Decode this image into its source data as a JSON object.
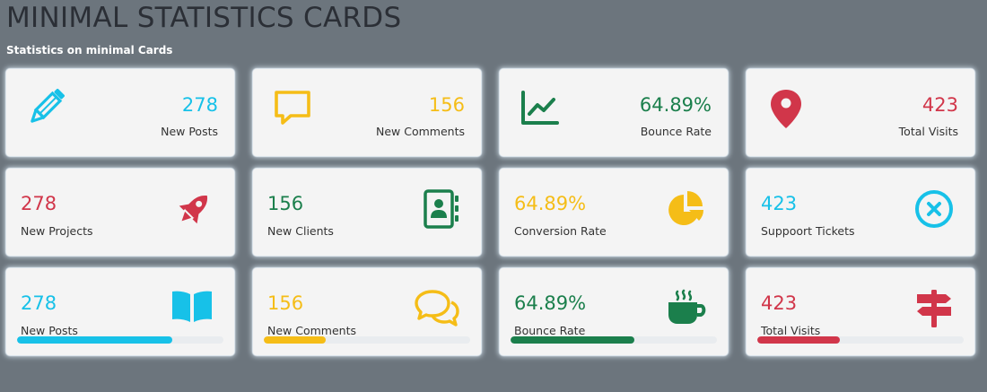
{
  "page": {
    "title": "MINIMAL STATISTICS CARDS",
    "subtitle": "Statistics on minimal Cards"
  },
  "colors": {
    "cyan": "#17c1e8",
    "yellow": "#f5bd17",
    "green": "#1b7f4c",
    "red": "#d1364a",
    "background": "#6c757d"
  },
  "cards": [
    {
      "value": "278",
      "label": "New Posts",
      "icon": "pencil-icon",
      "color": "cyan"
    },
    {
      "value": "156",
      "label": "New Comments",
      "icon": "speech-bubble-icon",
      "color": "yellow"
    },
    {
      "value": "64.89%",
      "label": "Bounce Rate",
      "icon": "line-graph-icon",
      "color": "green"
    },
    {
      "value": "423",
      "label": "Total Visits",
      "icon": "map-pin-icon",
      "color": "red"
    },
    {
      "value": "278",
      "label": "New Projects",
      "icon": "rocket-icon",
      "color": "red"
    },
    {
      "value": "156",
      "label": "New Clients",
      "icon": "address-book-icon",
      "color": "green"
    },
    {
      "value": "64.89%",
      "label": "Conversion Rate",
      "icon": "pie-chart-icon",
      "color": "yellow"
    },
    {
      "value": "423",
      "label": "Suppoort Tickets",
      "icon": "close-circle-icon",
      "color": "cyan"
    },
    {
      "value": "278",
      "label": "New Posts",
      "icon": "open-book-icon",
      "color": "cyan",
      "progress": 0.75
    },
    {
      "value": "156",
      "label": "New Comments",
      "icon": "chat-bubbles-icon",
      "color": "yellow",
      "progress": 0.3
    },
    {
      "value": "64.89%",
      "label": "Bounce Rate",
      "icon": "coffee-cup-icon",
      "color": "green",
      "progress": 0.6
    },
    {
      "value": "423",
      "label": "Total Visits",
      "icon": "signpost-icon",
      "color": "red",
      "progress": 0.4
    }
  ]
}
